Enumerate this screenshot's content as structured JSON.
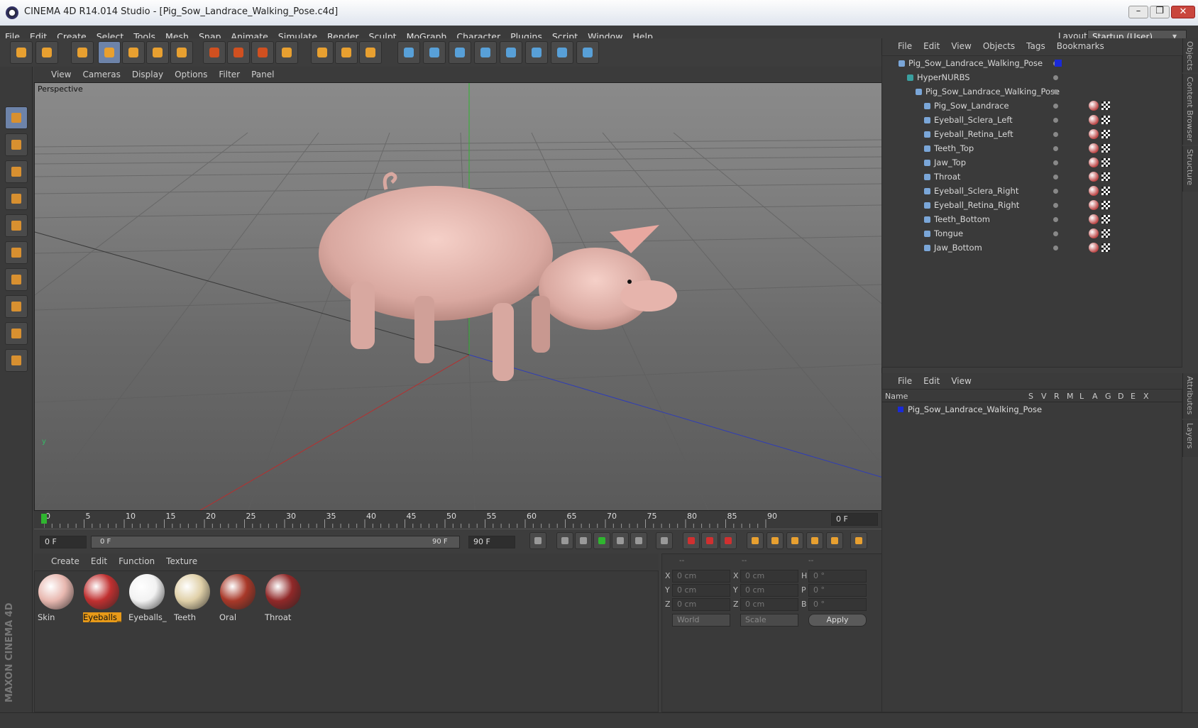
{
  "window": {
    "title": "CINEMA 4D R14.014 Studio - [Pig_Sow_Landrace_Walking_Pose.c4d]"
  },
  "menu": [
    "File",
    "Edit",
    "Create",
    "Select",
    "Tools",
    "Mesh",
    "Snap",
    "Animate",
    "Simulate",
    "Render",
    "Sculpt",
    "MoGraph",
    "Character",
    "Plugins",
    "Script",
    "Window",
    "Help"
  ],
  "layout": {
    "label": "Layout:",
    "value": "Startup (User)"
  },
  "viewport": {
    "menu": [
      "View",
      "Cameras",
      "Display",
      "Options",
      "Filter",
      "Panel"
    ],
    "label": "Perspective"
  },
  "objects_panel": {
    "menu": [
      "File",
      "Edit",
      "View",
      "Objects",
      "Tags",
      "Bookmarks"
    ],
    "items": [
      {
        "label": "Pig_Sow_Landrace_Walking_Pose",
        "depth": 0
      },
      {
        "label": "HyperNURBS",
        "depth": 1
      },
      {
        "label": "Pig_Sow_Landrace_Walking_Pose",
        "depth": 2
      },
      {
        "label": "Pig_Sow_Landrace",
        "depth": 3
      },
      {
        "label": "Eyeball_Sclera_Left",
        "depth": 3
      },
      {
        "label": "Eyeball_Retina_Left",
        "depth": 3
      },
      {
        "label": "Teeth_Top",
        "depth": 3
      },
      {
        "label": "Jaw_Top",
        "depth": 3
      },
      {
        "label": "Throat",
        "depth": 3
      },
      {
        "label": "Eyeball_Sclera_Right",
        "depth": 3
      },
      {
        "label": "Eyeball_Retina_Right",
        "depth": 3
      },
      {
        "label": "Teeth_Bottom",
        "depth": 3
      },
      {
        "label": "Tongue",
        "depth": 3
      },
      {
        "label": "Jaw_Bottom",
        "depth": 3
      }
    ]
  },
  "layers_panel": {
    "menu": [
      "File",
      "Edit",
      "View"
    ],
    "columns": [
      "Name",
      "S",
      "V",
      "R",
      "M",
      "L",
      "A",
      "G",
      "D",
      "E",
      "X"
    ],
    "rows": [
      "Pig_Sow_Landrace_Walking_Pose"
    ]
  },
  "side_tabs": {
    "top": [
      "Objects",
      "Content Browser",
      "Structure"
    ],
    "bottom": [
      "Attributes",
      "Layers"
    ]
  },
  "timeline": {
    "ticks": [
      "0",
      "5",
      "10",
      "15",
      "20",
      "25",
      "30",
      "35",
      "40",
      "45",
      "50",
      "55",
      "60",
      "65",
      "70",
      "75",
      "80",
      "85",
      "90"
    ],
    "current": "0 F",
    "start": "0 F",
    "range_start": "0 F",
    "range_end": "90 F",
    "end": "90 F"
  },
  "materials": {
    "menu": [
      "Create",
      "Edit",
      "Function",
      "Texture"
    ],
    "items": [
      {
        "name": "Skin",
        "color": "#e8b8b0"
      },
      {
        "name": "Eyeballs_Sc",
        "color": "#c03030",
        "selected": true
      },
      {
        "name": "Eyeballs_Re",
        "color": "#f2f2f2"
      },
      {
        "name": "Teeth",
        "color": "#e0d0a8"
      },
      {
        "name": "Oral",
        "color": "#a83828"
      },
      {
        "name": "Throat",
        "color": "#902828"
      }
    ]
  },
  "coordinates": {
    "headers": [
      "--",
      "--",
      "--"
    ],
    "rows": [
      {
        "a": "X",
        "av": "0 cm",
        "b": "X",
        "bv": "0 cm",
        "c": "H",
        "cv": "0 °"
      },
      {
        "a": "Y",
        "av": "0 cm",
        "b": "Y",
        "bv": "0 cm",
        "c": "P",
        "cv": "0 °"
      },
      {
        "a": "Z",
        "av": "0 cm",
        "b": "Z",
        "bv": "0 cm",
        "c": "B",
        "cv": "0 °"
      }
    ],
    "mode": "World",
    "type": "Scale",
    "apply": "Apply"
  },
  "brand": "MAXON CINEMA 4D"
}
